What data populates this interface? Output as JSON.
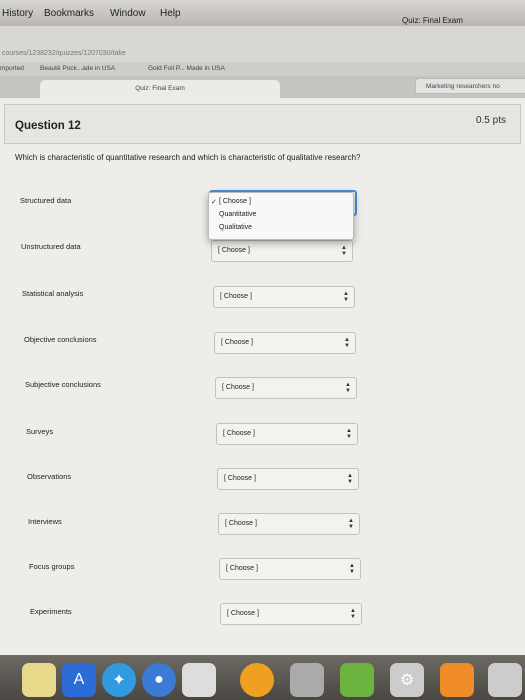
{
  "menubar": {
    "items": [
      "History",
      "Bookmarks",
      "Window",
      "Help"
    ],
    "window_title": "Quiz: Final Exam"
  },
  "url": "courses/1238232/quizzes/1207030/take",
  "bookmarks": [
    "mported",
    "Beauté Pock...ade in USA",
    "Gold Foil P... Made in USA"
  ],
  "tabs": [
    {
      "label": "Quiz: Final Exam",
      "active": true
    },
    {
      "label": "Marketing researchers no",
      "active": false
    }
  ],
  "question": {
    "title": "Question 12",
    "points": "0.5 pts",
    "text": "Which is characteristic of quantitative research and which is characteristic of qualitative research?"
  },
  "rows": [
    {
      "label": "Structured data",
      "value": "[ Choose ]"
    },
    {
      "label": "Unstructured data",
      "value": "[ Choose ]"
    },
    {
      "label": "Statistical analysis",
      "value": "[ Choose ]"
    },
    {
      "label": "Objective conclusions",
      "value": "[ Choose ]"
    },
    {
      "label": "Subjective conclusions",
      "value": "[ Choose ]"
    },
    {
      "label": "Surveys",
      "value": "[ Choose ]"
    },
    {
      "label": "Observations",
      "value": "[ Choose ]"
    },
    {
      "label": "Interviews",
      "value": "[ Choose ]"
    },
    {
      "label": "Focus groups",
      "value": "[ Choose ]"
    },
    {
      "label": "Experiments",
      "value": "[ Choose ]"
    }
  ],
  "dropdown": {
    "options": [
      "[ Choose ]",
      "Quantitative",
      "Qualitative"
    ],
    "selected_index": 0
  },
  "colors": {
    "focus": "#4a8fd8"
  }
}
